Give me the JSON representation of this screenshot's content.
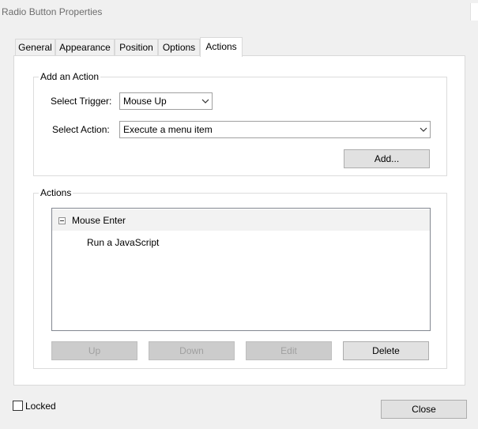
{
  "window": {
    "title": "Radio Button Properties"
  },
  "tabs": [
    {
      "label": "General",
      "active": false
    },
    {
      "label": "Appearance",
      "active": false
    },
    {
      "label": "Position",
      "active": false
    },
    {
      "label": "Options",
      "active": false
    },
    {
      "label": "Actions",
      "active": true
    }
  ],
  "add_action": {
    "group_label": "Add an Action",
    "trigger_label": "Select Trigger:",
    "trigger_value": "Mouse Up",
    "action_label": "Select Action:",
    "action_value": "Execute a menu item",
    "add_button": "Add..."
  },
  "actions": {
    "group_label": "Actions",
    "items": [
      {
        "trigger": "Mouse Enter",
        "actions": [
          "Run a JavaScript"
        ]
      }
    ],
    "buttons": {
      "up": "Up",
      "down": "Down",
      "edit": "Edit",
      "delete": "Delete"
    }
  },
  "footer": {
    "locked_label": "Locked",
    "locked_checked": false,
    "close_button": "Close"
  }
}
